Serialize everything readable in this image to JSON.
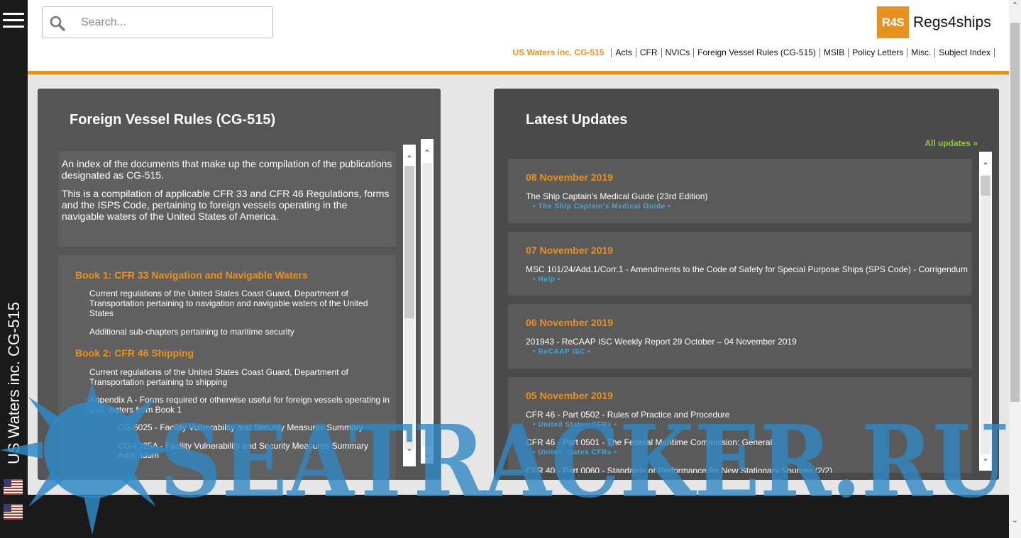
{
  "sidebar": {
    "title": "US Waters inc. CG-515"
  },
  "header": {
    "search_placeholder": "Search...",
    "logo_mark": "R4S",
    "logo_text": "Regs4ships",
    "nav_active": "US Waters inc. CG-515",
    "nav_items": [
      "Acts",
      "CFR",
      "NVICs",
      "Foreign Vessel Rules (CG-515)",
      "MSIB",
      "Policy Letters",
      "Misc.",
      "Subject Index"
    ]
  },
  "left_panel": {
    "title": "Foreign Vessel Rules (CG-515)",
    "intro": [
      "An index of the documents that make up the compilation of the publications designated as CG-515.",
      "This is a compilation of applicable CFR 33 and CFR 46 Regulations, forms and the ISPS Code, pertaining to foreign vessels operating in the navigable waters of the United States of America."
    ],
    "book1": {
      "title": "Book 1: CFR 33 Navigation and Navigable Waters",
      "items": [
        "Current regulations of the United States Coast Guard, Department of Transportation pertaining to navigation and navigable waters of the United States",
        "Additional sub-chapters pertaining to maritime security"
      ]
    },
    "book2": {
      "title": "Book 2: CFR 46 Shipping",
      "items": [
        "Current regulations of the United States Coast Guard, Department of Transportation pertaining to shipping",
        "Appendix A - Forms required or otherwise useful for foreign vessels operating in U.S. waters from Book 1"
      ],
      "subitems": [
        "CG-6025 - Facility Vulnerability and Security Measures Summary",
        "CG-6025A - Facility Vulnerability and Security Measures Summary Addendum"
      ]
    }
  },
  "right_panel": {
    "title": "Latest Updates",
    "all_updates": "All updates »",
    "updates": [
      {
        "date": "08 November 2019",
        "title": "The Ship Captain's Medical Guide (23rd Edition)",
        "tag": "• The Ship Captain's Medical Guide •"
      },
      {
        "date": "07 November 2019",
        "title": "MSC 101/24/Add.1/Corr.1 - Amendments to the Code of Safety for Special Purpose Ships (SPS Code) - Corrigendum",
        "tag": "• Help •"
      },
      {
        "date": "06 November 2019",
        "title": "201943 - ReCAAP ISC Weekly Report 29 October – 04 November 2019",
        "tag": "• ReCAAP ISC •"
      },
      {
        "date": "05 November 2019",
        "entries": [
          {
            "title": "CFR 46 - Part 0502 - Rules of Practice and Procedure",
            "tag": "• United States CFRs •"
          },
          {
            "title": "CFR 46 - Part 0501 - The Federal Maritime Commission: General",
            "tag": "• United States CFRs •"
          },
          {
            "title": "CFR 40 - Part 0060 - Standards of Performance for New Stationary Sources (2/2)"
          }
        ]
      }
    ]
  },
  "watermark": {
    "text": "SEATRACKER.RU"
  },
  "colors": {
    "accent": "#e8911f",
    "link_green": "#8dc63f",
    "tag_blue": "#3fa9e0",
    "panel": "#555555"
  },
  "icons": {
    "menu": "hamburger-icon",
    "search": "magnifier-icon",
    "flag": "us-flag-icon"
  }
}
